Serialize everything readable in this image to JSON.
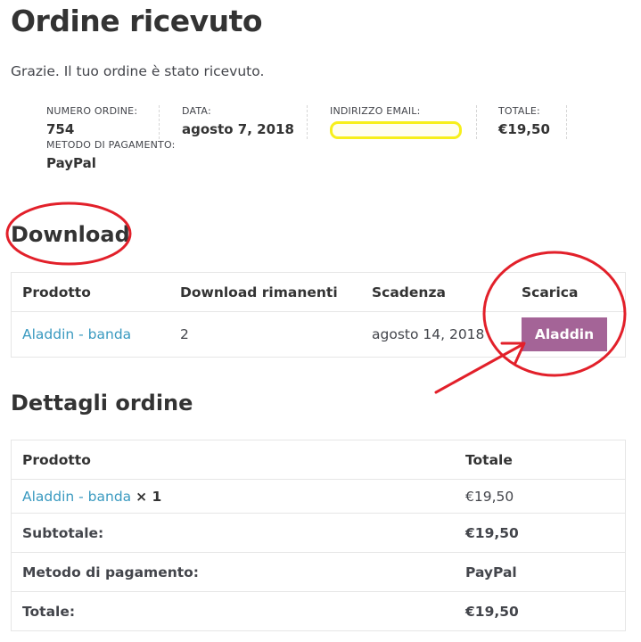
{
  "page": {
    "title": "Ordine ricevuto",
    "thankyou": "Grazie. Il tuo ordine è stato ricevuto."
  },
  "overview": {
    "order_number": {
      "label": "NUMERO ORDINE:",
      "value": "754"
    },
    "date": {
      "label": "DATA:",
      "value": "agosto 7, 2018"
    },
    "email": {
      "label": "INDIRIZZO EMAIL:",
      "value": ""
    },
    "total": {
      "label": "TOTALE:",
      "value": "€19,50"
    },
    "payment_method": {
      "label": "METODO DI PAGAMENTO:",
      "value": "PayPal"
    }
  },
  "downloads": {
    "title": "Download",
    "headers": [
      "Prodotto",
      "Download rimanenti",
      "Scadenza",
      "Scarica"
    ],
    "rows": [
      {
        "product": "Aladdin - banda",
        "remaining": "2",
        "expires": "agosto 14, 2018",
        "download_label": "Aladdin"
      }
    ]
  },
  "order_details": {
    "title": "Dettagli ordine",
    "headers": [
      "Prodotto",
      "Totale"
    ],
    "item": {
      "product": "Aladdin - banda",
      "qty": "× 1",
      "total": "€19,50"
    },
    "subtotal": {
      "label": "Subtotale:",
      "value": "€19,50"
    },
    "payment": {
      "label": "Metodo di pagamento:",
      "value": "PayPal"
    },
    "grand_total": {
      "label": "Totale:",
      "value": "€19,50"
    }
  },
  "colors": {
    "button": "#a46497",
    "link": "#3a9ac0",
    "annotation": "#e2202a",
    "highlight": "#f7ef1c"
  }
}
